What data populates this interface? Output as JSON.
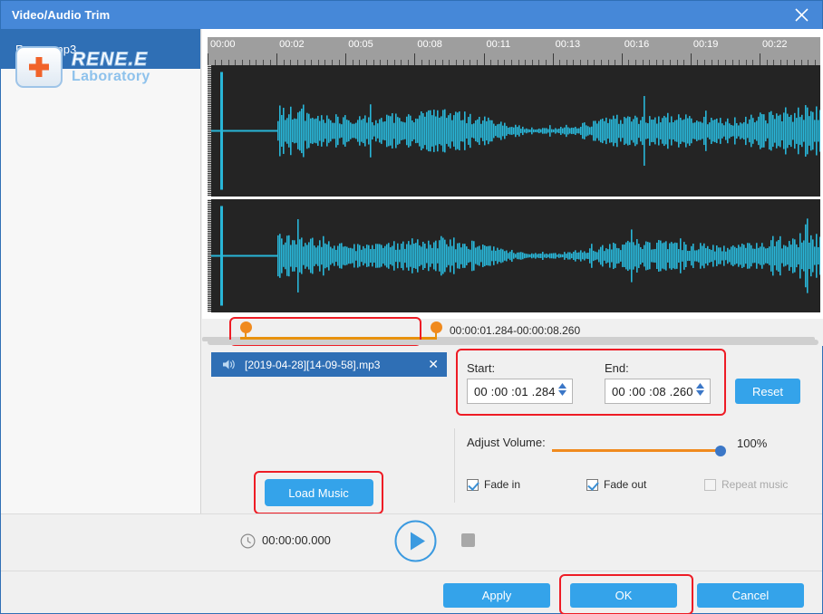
{
  "window": {
    "title": "Video/Audio Trim",
    "close_icon": "close-icon"
  },
  "sidebar": {
    "items": [
      {
        "label": "Renee.mp3",
        "active": true
      }
    ]
  },
  "timeline": {
    "ruler_labels": [
      "00:00",
      "00:02",
      "00:05",
      "00:08",
      "00:11",
      "00:13",
      "00:16",
      "00:19",
      "00:22"
    ],
    "waveform_color": "#29b6d8",
    "background_color": "#242424"
  },
  "trim": {
    "range_text": "00:00:01.284-00:00:08.260",
    "handle_color": "#f08a1e",
    "highlight_color": "#ee1c25"
  },
  "file_item": {
    "speaker_icon": "speaker-icon",
    "name": "[2019-04-28][14-09-58].mp3",
    "close_icon": "close-icon"
  },
  "load_music": {
    "label": "Load Music"
  },
  "settings": {
    "start_label": "Start:",
    "start_value": "00 :00 :01 .284",
    "end_label": "End:",
    "end_value": "00 :00 :08 .260",
    "reset_label": "Reset",
    "volume_label": "Adjust Volume:",
    "volume_value": "100%",
    "volume_percent": 100,
    "checkboxes": [
      {
        "label": "Fade in",
        "checked": true,
        "disabled": false
      },
      {
        "label": "Fade out",
        "checked": true,
        "disabled": false
      },
      {
        "label": "Repeat music",
        "checked": false,
        "disabled": true
      }
    ]
  },
  "player": {
    "clock_icon": "clock-icon",
    "current_time": "00:00:00.000",
    "play_icon": "play-icon",
    "stop_icon": "stop-icon"
  },
  "logo": {
    "main": "RENE.E",
    "sub": "Laboratory"
  },
  "actions": {
    "apply": "Apply",
    "ok": "OK",
    "cancel": "Cancel"
  }
}
